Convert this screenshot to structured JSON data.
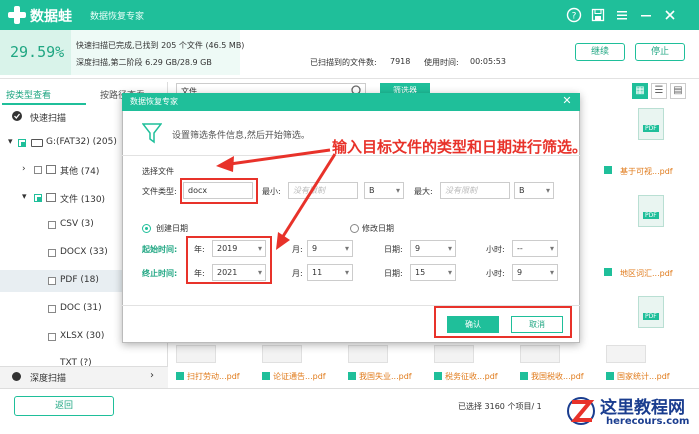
{
  "app": {
    "name": "数据蛙",
    "subtitle": "数据恢复专家",
    "colors": {
      "accent": "#1fbf9a",
      "annotation": "#e8322a",
      "filename": "#e07a1a"
    },
    "window_icons": [
      "help-icon",
      "save-icon",
      "menu-icon",
      "minimize-icon",
      "close-icon"
    ]
  },
  "progress": {
    "percent_text": "29.59%",
    "percent_value": 29.59,
    "line1": "快速扫描已完成,已找到 205 个文件 (46.5 MB)",
    "line2": "深度扫描,第二阶段 6.29 GB/28.9 GB",
    "found_label": "已扫描到的文件数:",
    "found_count": "7918",
    "time_label": "使用时间:",
    "time_value": "00:05:53",
    "continue_label": "继续",
    "stop_label": "停止"
  },
  "left_panel": {
    "tab_type": "按类型查看",
    "tab_path": "按路径查看",
    "quick_scan": "快速扫描",
    "drive": "G:(FAT32) (205)",
    "other": "其他 (74)",
    "documents": "文件 (130)",
    "items": [
      {
        "label": "CSV (3)"
      },
      {
        "label": "DOCX (33)"
      },
      {
        "label": "PDF (18)"
      },
      {
        "label": "DOC (31)"
      },
      {
        "label": "XLSX (30)"
      },
      {
        "label": "TXT (?)"
      }
    ],
    "deep_scan": "深度扫描",
    "back_label": "返回"
  },
  "toolbar": {
    "search_value": "文件",
    "filter_label": "筛选器"
  },
  "files": {
    "col1": [
      "基于可视...pdf",
      "地区词汇...pdf"
    ],
    "bottom_row": [
      "扫打劳动...pdf",
      "论证通告...pdf",
      "我国失业...pdf",
      "税务征收...pdf",
      "我国税收...pdf",
      "国家统计...pdf"
    ],
    "selected_text": "已选择 3160 个项目/ 1"
  },
  "dialog": {
    "title": "数据恢复专家",
    "description": "设置筛选条件信息,然后开始筛选。",
    "section_file": "选择文件",
    "file_type_label": "文件类型:",
    "file_type_value": "docx",
    "min_label": "最小:",
    "min_placeholder": "没有限制",
    "min_unit": "B",
    "max_label": "最大:",
    "max_placeholder": "没有限制",
    "max_unit": "B",
    "created_label": "创建日期",
    "modified_label": "修改日期",
    "start_label": "起始时间:",
    "end_label": "终止时间:",
    "year_label": "年:",
    "month_label": "月:",
    "day_label": "日期:",
    "hour_label": "小时:",
    "start": {
      "year": "2019",
      "month": "9",
      "day": "9",
      "hour": "--"
    },
    "end": {
      "year": "2021",
      "month": "11",
      "day": "15",
      "hour": "9"
    },
    "ok_label": "确认",
    "cancel_label": "取消"
  },
  "annotation": {
    "text": "输入目标文件的类型和日期进行筛选。"
  },
  "watermark": {
    "text": "这里教程网",
    "url": "herecours.com"
  }
}
